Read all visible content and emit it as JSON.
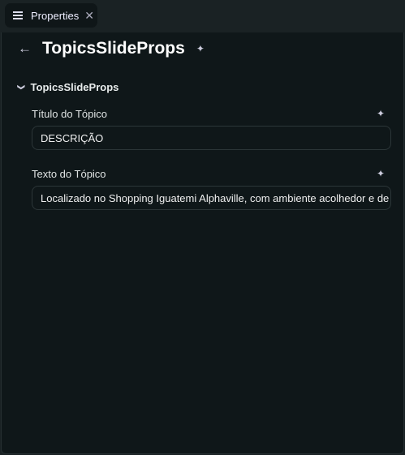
{
  "tab": {
    "label": "Properties",
    "icon": "list-icon"
  },
  "header": {
    "title": "TopicsSlideProps"
  },
  "section": {
    "label": "TopicsSlideProps"
  },
  "fields": [
    {
      "label": "Título do Tópico",
      "value": "DESCRIÇÃO"
    },
    {
      "label": "Texto do Tópico",
      "value": "Localizado no Shopping Iguatemi Alphaville, com ambiente acolhedor e de"
    }
  ]
}
